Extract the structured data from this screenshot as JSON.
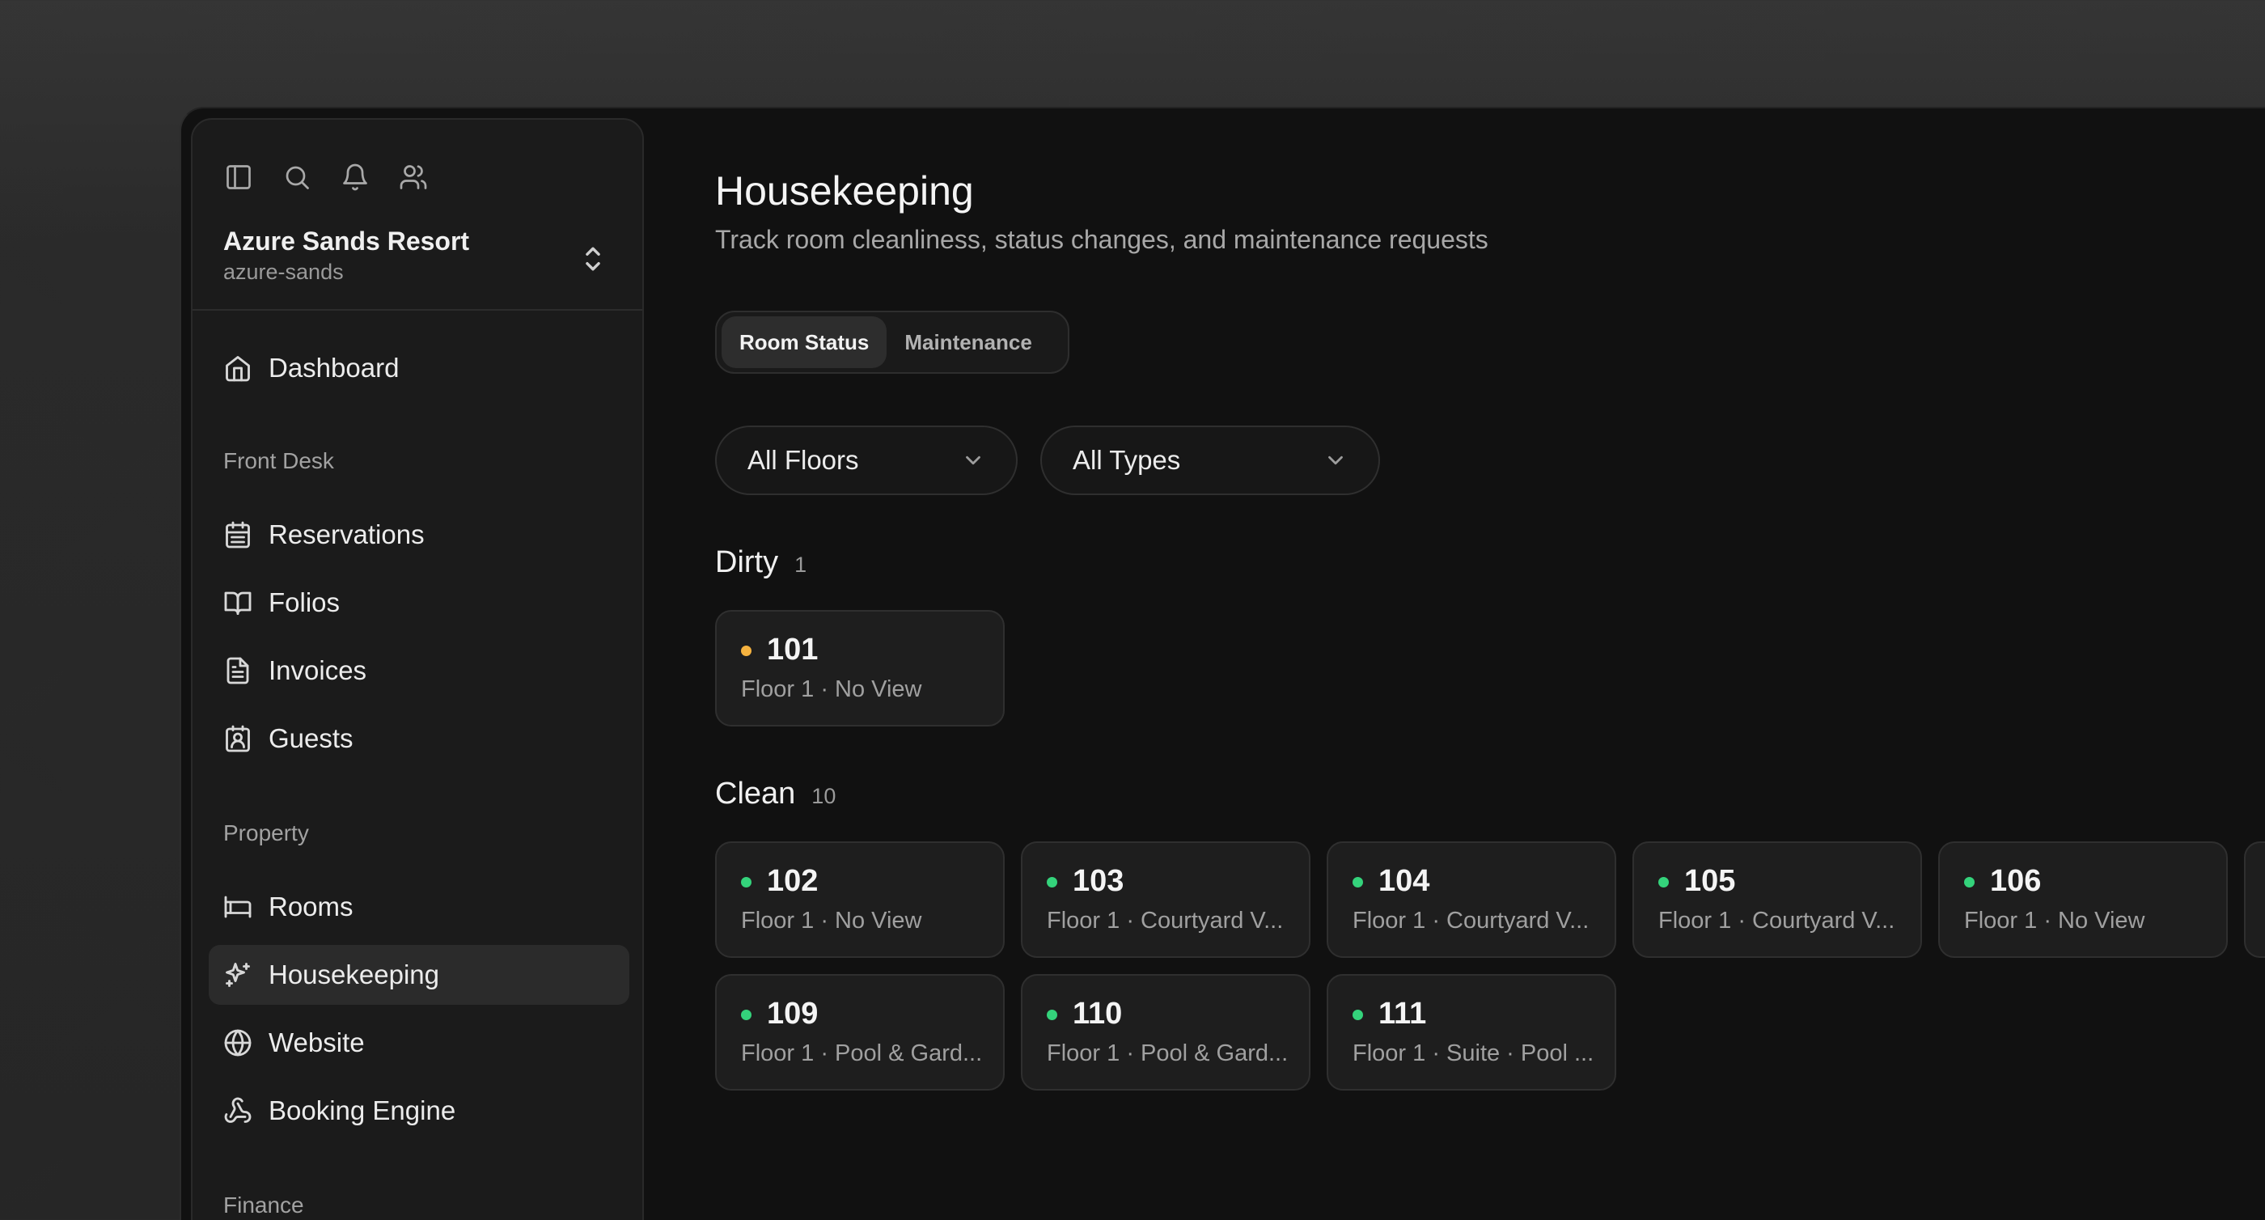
{
  "sidebar": {
    "org": {
      "name": "Azure Sands Resort",
      "slug": "azure-sands"
    },
    "top_items": [
      {
        "label": "Dashboard"
      }
    ],
    "sections": [
      {
        "label": "Front Desk",
        "items": [
          {
            "label": "Reservations"
          },
          {
            "label": "Folios"
          },
          {
            "label": "Invoices"
          },
          {
            "label": "Guests"
          }
        ]
      },
      {
        "label": "Property",
        "items": [
          {
            "label": "Rooms"
          },
          {
            "label": "Housekeeping"
          },
          {
            "label": "Website"
          },
          {
            "label": "Booking Engine"
          }
        ]
      },
      {
        "label": "Finance",
        "items": []
      }
    ],
    "active_item": "Housekeeping"
  },
  "page": {
    "title": "Housekeeping",
    "subtitle": "Track room cleanliness, status changes, and maintenance requests"
  },
  "tabs": [
    {
      "label": "Room Status",
      "active": true
    },
    {
      "label": "Maintenance",
      "active": false
    }
  ],
  "filters": [
    {
      "value": "All Floors"
    },
    {
      "value": "All Types"
    }
  ],
  "colors": {
    "dirty": "#f5b23f",
    "clean": "#34d37b",
    "accent_bg": "#111111"
  },
  "groups": [
    {
      "name": "Dirty",
      "count": "1",
      "rooms": [
        {
          "number": "101",
          "meta": "Floor 1 · No View"
        }
      ]
    },
    {
      "name": "Clean",
      "count": "10",
      "rooms": [
        {
          "number": "102",
          "meta": "Floor 1 · No View"
        },
        {
          "number": "103",
          "meta": "Floor 1 · Courtyard V..."
        },
        {
          "number": "104",
          "meta": "Floor 1 · Courtyard V..."
        },
        {
          "number": "105",
          "meta": "Floor 1 · Courtyard V..."
        },
        {
          "number": "106",
          "meta": "Floor 1 · No View"
        },
        {
          "number": "109",
          "meta": "Floor 1 · Pool & Gard..."
        },
        {
          "number": "110",
          "meta": "Floor 1 · Pool & Gard..."
        },
        {
          "number": "111",
          "meta": "Floor 1 · Suite · Pool ..."
        }
      ]
    }
  ]
}
